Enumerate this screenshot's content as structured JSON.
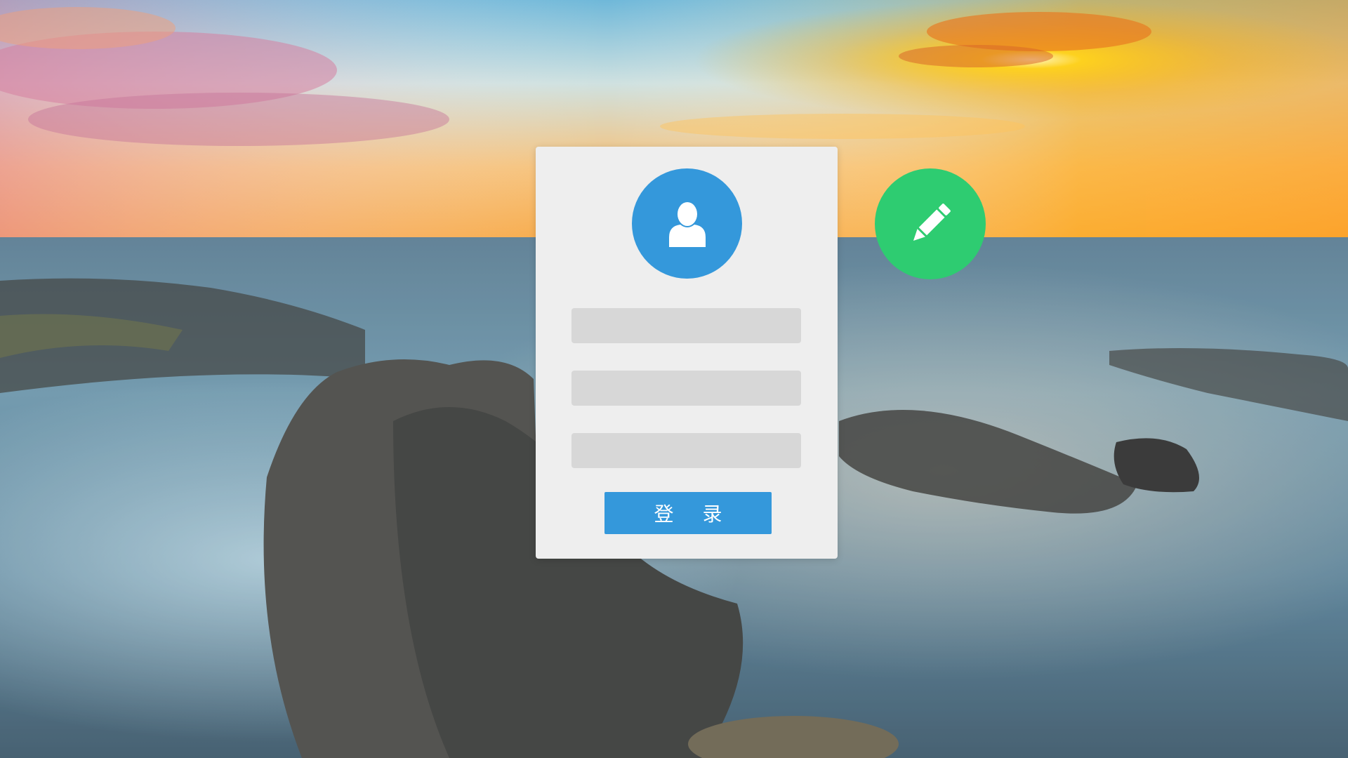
{
  "login_form": {
    "submit_label": "登 录",
    "fields": [
      {
        "value": "",
        "placeholder": ""
      },
      {
        "value": "",
        "placeholder": ""
      },
      {
        "value": "",
        "placeholder": ""
      }
    ]
  },
  "icons": {
    "avatar": "user-icon",
    "edit": "pencil-icon"
  },
  "colors": {
    "primary_blue": "#3498db",
    "accent_green": "#2ecc71",
    "card_background": "#eeeeee",
    "field_background": "#d7d7d7"
  }
}
